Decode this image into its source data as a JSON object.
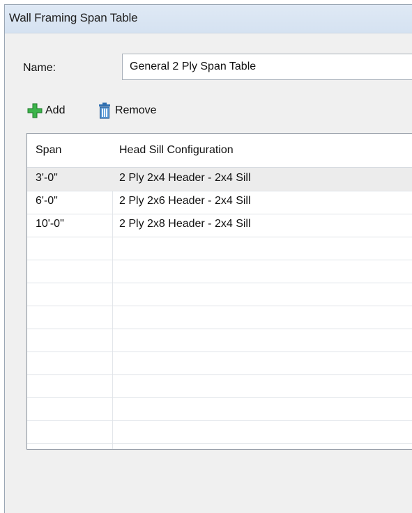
{
  "window": {
    "title": "Wall Framing Span Table"
  },
  "name_field": {
    "label": "Name:",
    "value": "General 2 Ply Span Table"
  },
  "toolbar": {
    "add_label": "Add",
    "remove_label": "Remove"
  },
  "table": {
    "columns": [
      "Span",
      "Head Sill Configuration"
    ],
    "rows": [
      {
        "span": "3'-0\"",
        "config": "2 Ply 2x4 Header - 2x4 Sill"
      },
      {
        "span": "6'-0\"",
        "config": "2 Ply 2x6 Header - 2x4 Sill"
      },
      {
        "span": "10'-0\"",
        "config": "2 Ply 2x8 Header - 2x4 Sill"
      }
    ],
    "selected_row": 0
  },
  "colors": {
    "title_bar": "#dfe9f5",
    "add_icon": "#3cb44b",
    "remove_icon": "#2f6fb0"
  }
}
